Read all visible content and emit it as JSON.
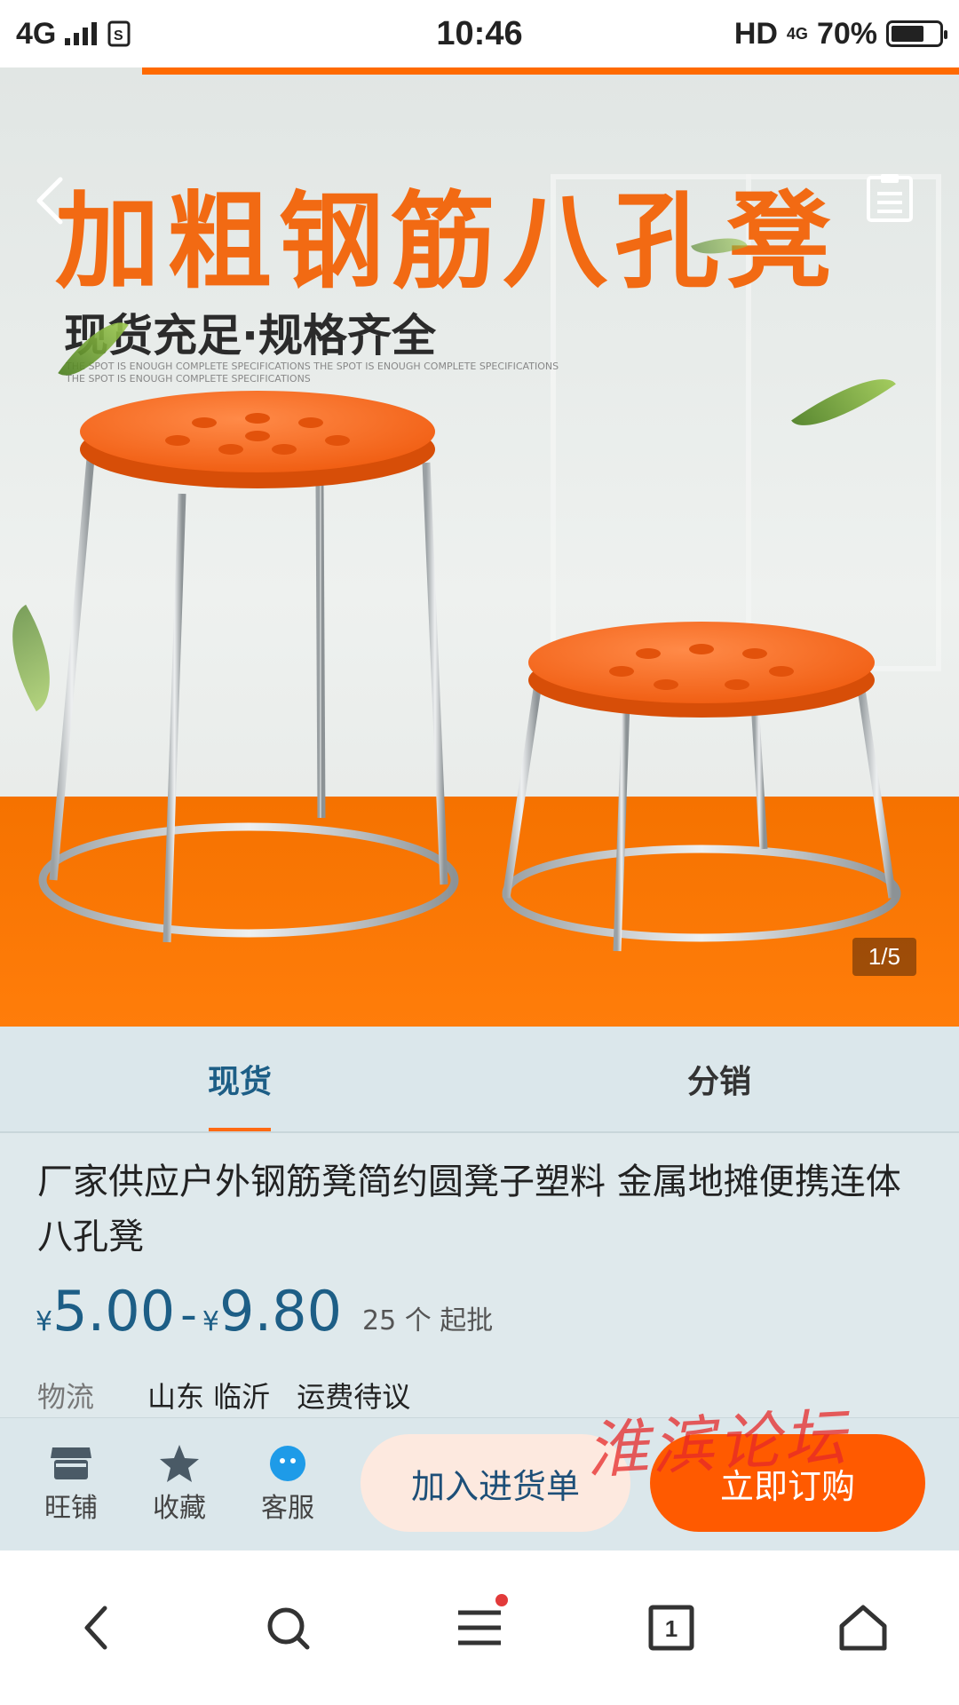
{
  "status_bar": {
    "network": "4G",
    "time": "10:46",
    "hd": "HD",
    "net4g": "4G",
    "battery": "70%",
    "battery_level": 0.7
  },
  "hero": {
    "headline": "加粗钢筋八孔凳",
    "subheadline": "现货充足·规格齐全",
    "tiny_line_1": "THE SPOT IS ENOUGH COMPLETE SPECIFICATIONS THE SPOT IS ENOUGH COMPLETE SPECIFICATIONS",
    "tiny_line_2": "THE SPOT IS ENOUGH COMPLETE SPECIFICATIONS",
    "image_counter": "1/5",
    "colors": {
      "accent": "#ff6a00",
      "stool_seat": "#ff6a2a"
    }
  },
  "tabs": [
    {
      "label": "现货",
      "active": true
    },
    {
      "label": "分销",
      "active": false
    }
  ],
  "product": {
    "title": "厂家供应户外钢筋凳简约圆凳子塑料 金属地摊便携连体八孔凳",
    "currency": "¥",
    "price_low": "5.00",
    "price_high": "9.80",
    "moq": "25 个 起批",
    "logistics_label": "物流",
    "origin": "山东 临沂",
    "shipping": "运费待议"
  },
  "actions": {
    "shop_label": "旺铺",
    "favorite_label": "收藏",
    "service_label": "客服",
    "add_to_cart": "加入进货单",
    "buy_now": "立即订购"
  },
  "watermark": "淮滨论坛",
  "browser_nav": {
    "tabs_count": "1",
    "icons": [
      "back-icon",
      "search-icon",
      "menu-icon",
      "tabs-icon",
      "home-icon"
    ]
  }
}
